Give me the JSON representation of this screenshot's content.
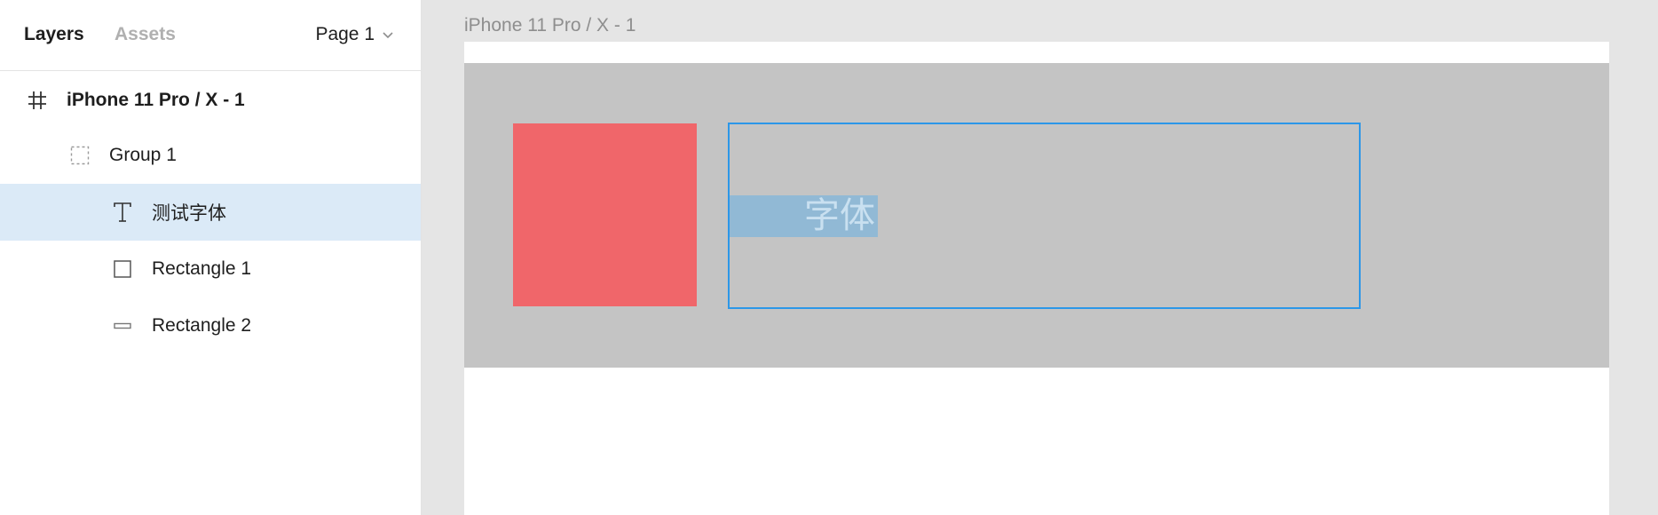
{
  "sidebar": {
    "tabs": {
      "layers": "Layers",
      "assets": "Assets"
    },
    "page_selector": {
      "label": "Page 1"
    },
    "layers": [
      {
        "label": "iPhone 11 Pro / X - 1",
        "icon": "frame-icon",
        "selected": false
      },
      {
        "label": "Group 1",
        "icon": "group-icon",
        "selected": false
      },
      {
        "label": "测试字体",
        "icon": "text-icon",
        "selected": true
      },
      {
        "label": "Rectangle 1",
        "icon": "rectangle-icon",
        "selected": false
      },
      {
        "label": "Rectangle 2",
        "icon": "line-rectangle-icon",
        "selected": false
      }
    ]
  },
  "canvas": {
    "frame_title": "iPhone 11 Pro / X - 1",
    "text_layer_content": "字体",
    "colors": {
      "canvas_bg": "#e5e5e5",
      "frame_bg": "#ffffff",
      "group_bg": "#c4c4c4",
      "rectangle_fill": "#f0666a",
      "selection_border": "#2c97e8",
      "text_selection": "#91b9d5",
      "layer_selected": "#dbeaf7"
    }
  }
}
